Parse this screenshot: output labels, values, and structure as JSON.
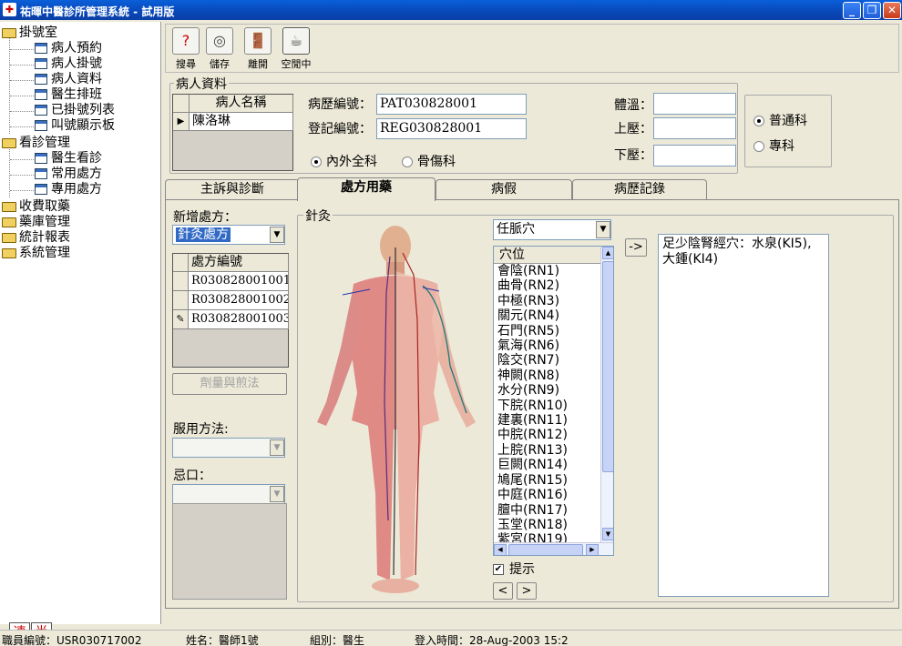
{
  "window": {
    "title": "祐暉中醫診所管理系統 - 試用版",
    "app_icon_glyph": "✚"
  },
  "tree": {
    "groups": [
      {
        "label": "掛號室",
        "items": [
          "病人預約",
          "病人掛號",
          "病人資料",
          "醫生排班",
          "已掛號列表",
          "叫號顯示板"
        ]
      },
      {
        "label": "看診管理",
        "items": [
          "醫生看診",
          "常用處方",
          "專用處方"
        ]
      },
      {
        "label": "收費取藥",
        "items": []
      },
      {
        "label": "藥庫管理",
        "items": []
      },
      {
        "label": "統計報表",
        "items": []
      },
      {
        "label": "系統管理",
        "items": []
      }
    ]
  },
  "toolbar": {
    "search": "搜尋",
    "save": "儲存",
    "leave": "離開",
    "idle": "空閒中"
  },
  "patient": {
    "group_label": "病人資料",
    "name_header": "病人名稱",
    "name_value": "陳洛琳",
    "record_no_label": "病歷編號：",
    "record_no": "PAT030828001",
    "reg_no_label": "登記編號：",
    "reg_no": "REG030828001",
    "dept_internal": "內外全科",
    "dept_bone": "骨傷科",
    "temp_label": "體溫：",
    "sys_label": "上壓：",
    "dia_label": "下壓：",
    "temp": "",
    "sys": "",
    "dia": "",
    "general": "普通科",
    "special": "專科"
  },
  "tabs": [
    "主訴與診斷",
    "處方用藥",
    "病假",
    "病歷記錄"
  ],
  "prescription": {
    "new_label": "新增處方：",
    "new_value": "針灸處方",
    "list_header": "處方編號",
    "list": [
      "R030828001001",
      "R030828001002",
      "R030828001003"
    ],
    "dosage_button": "劑量與煎法",
    "usage_label": "服用方法:",
    "usage_value": "",
    "taboo_label": "忌口：",
    "taboo_value": ""
  },
  "acupuncture": {
    "group_label": "針灸",
    "meridian_value": "任脈穴",
    "points_header": "穴位",
    "points": [
      "會陰(RN1)",
      "曲骨(RN2)",
      "中極(RN3)",
      "關元(RN4)",
      "石門(RN5)",
      "氣海(RN6)",
      "陰交(RN7)",
      "神闕(RN8)",
      "水分(RN9)",
      "下脘(RN10)",
      "建裏(RN11)",
      "中脘(RN12)",
      "上脘(RN13)",
      "巨闕(RN14)",
      "鳩尾(RN15)",
      "中庭(RN16)",
      "膻中(RN17)",
      "玉堂(RN18)",
      "紫宮(RN19)"
    ],
    "add_button": "->",
    "selected_text": "足少陰腎經穴：水泉(KI5), 大鍾(KI4)",
    "hint_label": "提示",
    "prev_button": "<",
    "next_button": ">"
  },
  "status": {
    "user_id": "職員編號：USR030717002",
    "user_name": "姓名：醫師1號",
    "group": "組別：醫生",
    "login_time": "登入時間：28-Aug-2003 15:2"
  },
  "ime": {
    "speed": "速",
    "half": "半"
  }
}
